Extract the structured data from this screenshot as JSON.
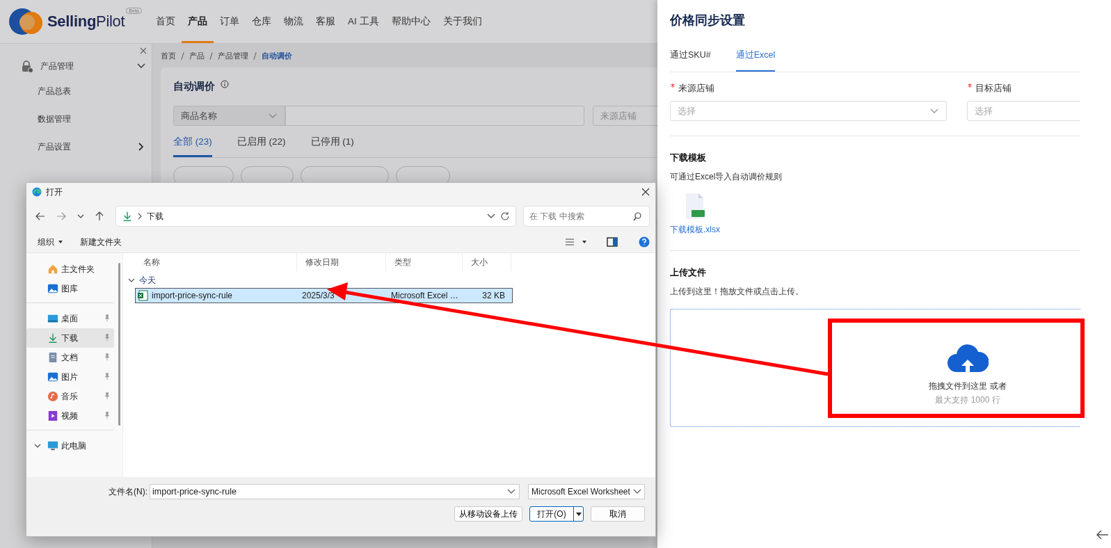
{
  "app": {
    "logo": {
      "name": "**Selling**Pilot",
      "badge": "Beta"
    },
    "nav": [
      {
        "label": "首页",
        "selected": false
      },
      {
        "label": "产品",
        "selected": true
      },
      {
        "label": "订单",
        "selected": false
      },
      {
        "label": "仓库",
        "selected": false
      },
      {
        "label": "物流",
        "selected": false
      },
      {
        "label": "客服",
        "selected": false
      },
      {
        "label": "AI 工具",
        "selected": false
      },
      {
        "label": "帮助中心",
        "selected": false
      },
      {
        "label": "关于我们",
        "selected": false
      }
    ],
    "sidebar": {
      "group": {
        "label": "产品管理",
        "expanded": true
      },
      "items": [
        {
          "label": "产品总表",
          "has_submenu": false
        },
        {
          "label": "数据管理",
          "has_submenu": false
        },
        {
          "label": "产品设置",
          "has_submenu": true
        }
      ]
    },
    "breadcrumb": [
      "首页",
      "产品",
      "产品管理",
      "自动调价"
    ],
    "page": {
      "title": "自动调价",
      "field_select": "商品名称",
      "store_placeholder": "来源店铺",
      "tabs": [
        {
          "label": "全部 (23)",
          "selected": true
        },
        {
          "label": "已启用 (22)",
          "selected": false
        },
        {
          "label": "已停用 (1)",
          "selected": false
        }
      ]
    }
  },
  "drawer": {
    "title": "价格同步设置",
    "tabs": [
      {
        "label": "通过SKU#",
        "selected": false
      },
      {
        "label": "通过Excel",
        "selected": true
      }
    ],
    "fields": [
      {
        "label": "来源店铺",
        "required": true,
        "placeholder": "选择"
      },
      {
        "label": "目标店铺",
        "required": true,
        "placeholder": "选择"
      }
    ],
    "template": {
      "heading": "下载模板",
      "description": "可通过Excel导入自动调价规则",
      "link": "下载模板.xlsx"
    },
    "upload": {
      "heading": "上传文件",
      "description": "上传到这里！拖放文件或点击上传。",
      "drop_text": "拖拽文件到这里 或者",
      "limit": "最大支持 1000 行"
    }
  },
  "file_dialog": {
    "title": "打开",
    "address": "下载",
    "search_placeholder": "在 下载 中搜索",
    "commands": [
      {
        "label": "组织",
        "kind": "menu"
      },
      {
        "label": "新建文件夹",
        "kind": "button"
      }
    ],
    "nav_groups": [
      [
        {
          "label": "主文件夹",
          "kind": "home",
          "pinned": false,
          "selected": false
        },
        {
          "label": "图库",
          "kind": "gallery",
          "pinned": false,
          "selected": false
        }
      ],
      [
        {
          "label": "桌面",
          "kind": "desktop",
          "pinned": true,
          "selected": false
        },
        {
          "label": "下载",
          "kind": "downloads",
          "pinned": true,
          "selected": true
        },
        {
          "label": "文档",
          "kind": "documents",
          "pinned": true,
          "selected": false
        },
        {
          "label": "图片",
          "kind": "pictures",
          "pinned": true,
          "selected": false
        },
        {
          "label": "音乐",
          "kind": "music",
          "pinned": true,
          "selected": false
        },
        {
          "label": "视频",
          "kind": "videos",
          "pinned": true,
          "selected": false
        }
      ],
      [
        {
          "label": "此电脑",
          "kind": "pc",
          "pinned": false,
          "selected": false,
          "expanded": true
        }
      ]
    ],
    "columns": [
      "名称",
      "修改日期",
      "类型",
      "大小"
    ],
    "group": {
      "label": "今天",
      "expanded": true
    },
    "files": [
      {
        "name": "import-price-sync-rule",
        "modified": "2025/3/3",
        "type": "Microsoft Excel …",
        "size": "32 KB",
        "selected": true
      }
    ],
    "filename_label": "文件名(N):",
    "filename": "import-price-sync-rule",
    "file_type": "Microsoft Excel Worksheet",
    "buttons": [
      {
        "label": "从移动设备上传",
        "kind": "secondary"
      },
      {
        "label": "打开(O)",
        "kind": "split"
      },
      {
        "label": "取消",
        "kind": "secondary"
      }
    ]
  }
}
